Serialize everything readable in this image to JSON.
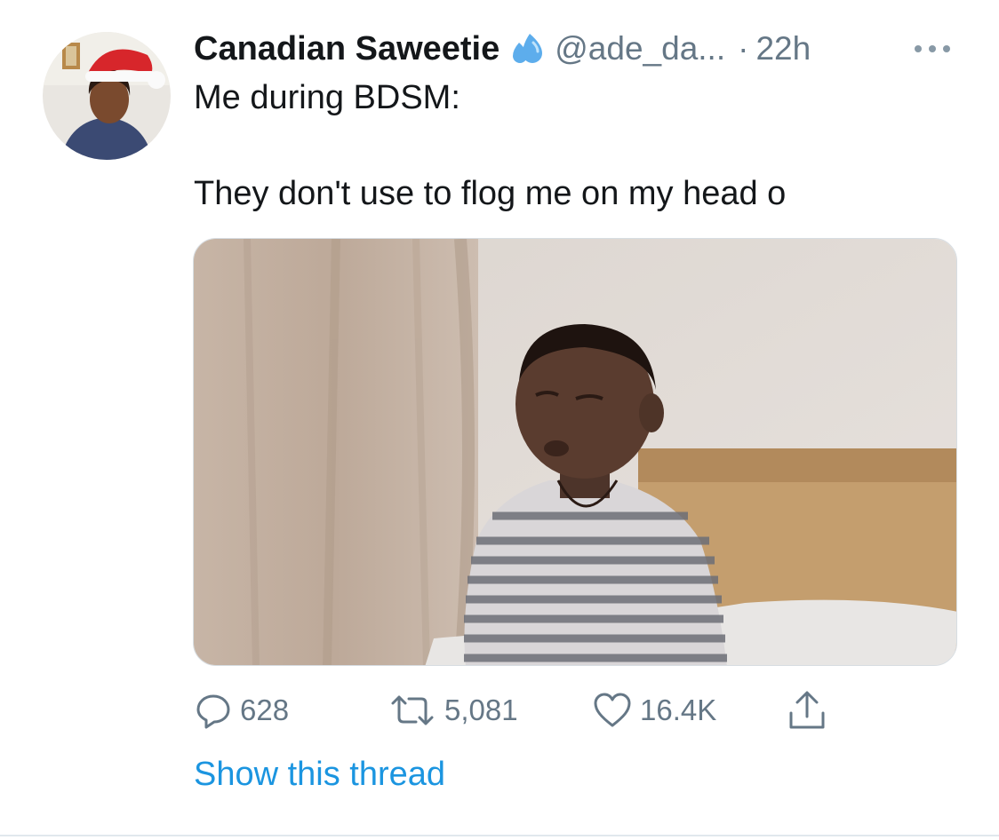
{
  "tweet": {
    "author": {
      "display_name": "Canadian Saweetie",
      "name_emoji": "sweat-droplets-emoji",
      "handle": "@ade_da...",
      "separator": "·",
      "time": "22h"
    },
    "text_line1": "Me during BDSM:",
    "text_line2": "They don't use to flog me on my head o",
    "media": {
      "description_icon": "photo-of-child-in-striped-shirt-on-bed"
    },
    "actions": {
      "replies": "628",
      "retweets": "5,081",
      "likes": "16.4K"
    },
    "thread_link": "Show this thread"
  },
  "colors": {
    "text_primary": "#14171a",
    "text_secondary": "#657786",
    "link": "#1b95e0",
    "divider": "#e1e8ed"
  }
}
